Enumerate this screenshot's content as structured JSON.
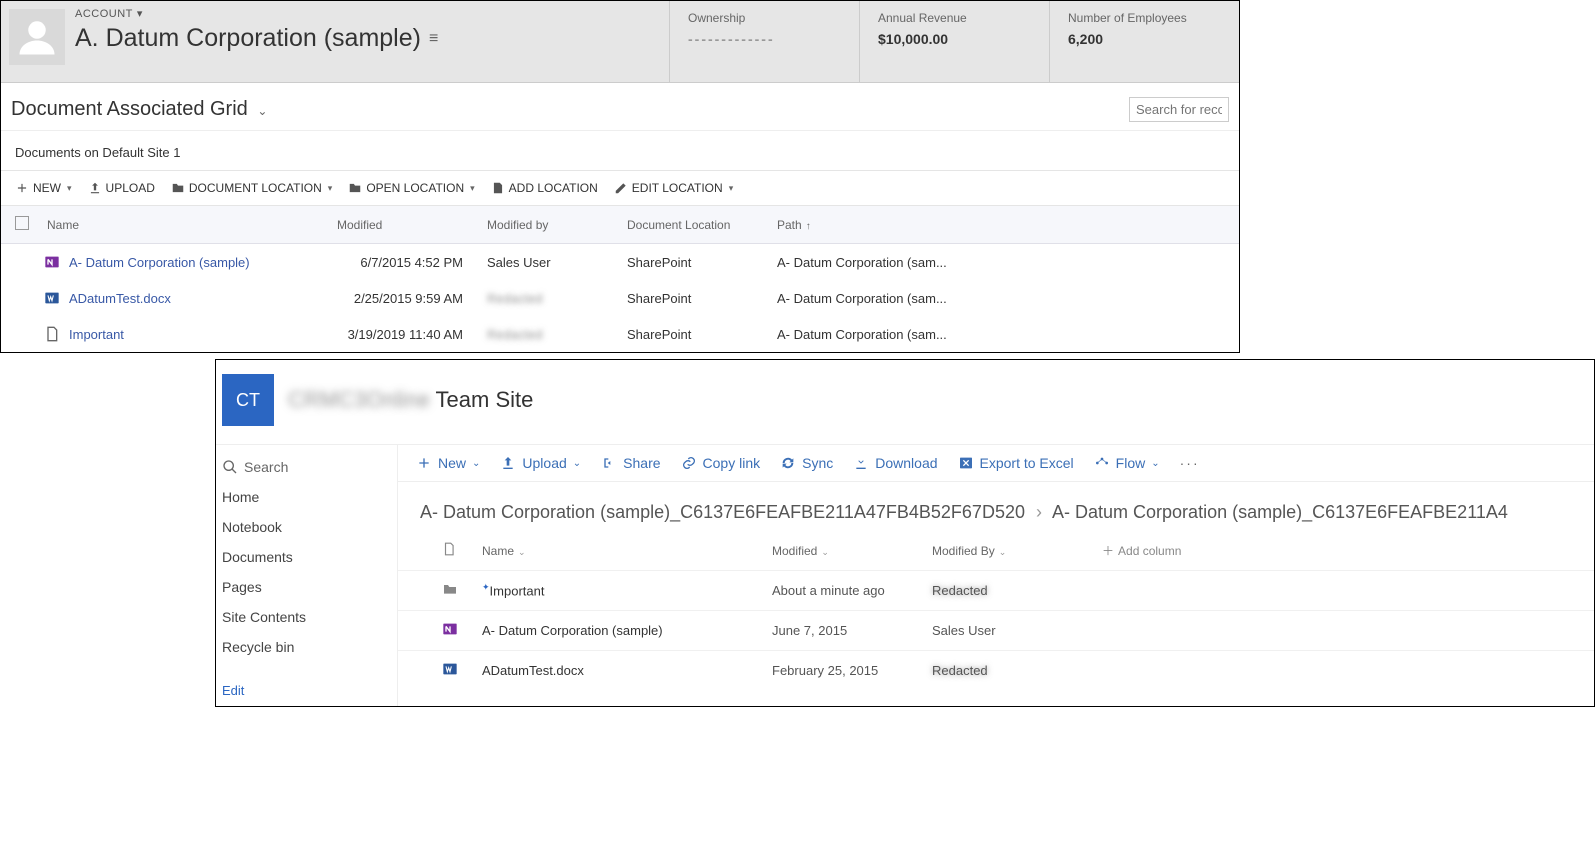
{
  "crm": {
    "account_label": "ACCOUNT",
    "record_title": "A. Datum Corporation (sample)",
    "stats": {
      "ownership": {
        "label": "Ownership",
        "value": "-------------"
      },
      "revenue": {
        "label": "Annual Revenue",
        "value": "$10,000.00"
      },
      "employees": {
        "label": "Number of Employees",
        "value": "6,200"
      }
    },
    "subgrid_title": "Document Associated Grid",
    "search_placeholder": "Search for reco",
    "subgrid_subtitle": "Documents on Default Site 1",
    "toolbar": {
      "new": "NEW",
      "upload": "UPLOAD",
      "doc_location": "DOCUMENT LOCATION",
      "open_location": "OPEN LOCATION",
      "add_location": "ADD LOCATION",
      "edit_location": "EDIT LOCATION"
    },
    "columns": {
      "name": "Name",
      "modified": "Modified",
      "modified_by": "Modified by",
      "doc_location": "Document Location",
      "path": "Path"
    },
    "rows": [
      {
        "icon": "onenote",
        "name": "A- Datum Corporation (sample)",
        "modified": "6/7/2015 4:52 PM",
        "by": "Sales User",
        "by_blur": false,
        "loc": "SharePoint",
        "path": "A- Datum Corporation (sam..."
      },
      {
        "icon": "word",
        "name": "ADatumTest.docx",
        "modified": "2/25/2015 9:59 AM",
        "by": "Redacted",
        "by_blur": true,
        "loc": "SharePoint",
        "path": "A- Datum Corporation (sam..."
      },
      {
        "icon": "page",
        "name": "Important",
        "modified": "3/19/2019 11:40 AM",
        "by": "Redacted",
        "by_blur": true,
        "loc": "SharePoint",
        "path": "A- Datum Corporation (sam..."
      }
    ]
  },
  "sp": {
    "tile": "CT",
    "site_prefix_blur": "CRMC3Online",
    "site_suffix": " Team Site",
    "search": "Search",
    "nav": [
      "Home",
      "Notebook",
      "Documents",
      "Pages",
      "Site Contents",
      "Recycle bin"
    ],
    "edit": "Edit",
    "cmdbar": {
      "new": "New",
      "upload": "Upload",
      "share": "Share",
      "copylink": "Copy link",
      "sync": "Sync",
      "download": "Download",
      "excel": "Export to Excel",
      "flow": "Flow"
    },
    "breadcrumb": {
      "a": "A- Datum Corporation (sample)_C6137E6FEAFBE211A47FB4B52F67D520",
      "b": "A- Datum Corporation (sample)_C6137E6FEAFBE211A4"
    },
    "columns": {
      "name": "Name",
      "modified": "Modified",
      "modified_by": "Modified By",
      "addcol": "Add column"
    },
    "rows": [
      {
        "icon": "folder",
        "name": "Important",
        "new": true,
        "modified": "About a minute ago",
        "by": "Redacted",
        "by_blur": true
      },
      {
        "icon": "onenote",
        "name": "A- Datum Corporation (sample)",
        "new": false,
        "modified": "June 7, 2015",
        "by": "Sales User",
        "by_blur": false
      },
      {
        "icon": "word",
        "name": "ADatumTest.docx",
        "new": false,
        "modified": "February 25, 2015",
        "by": "Redacted",
        "by_blur": true
      }
    ]
  }
}
